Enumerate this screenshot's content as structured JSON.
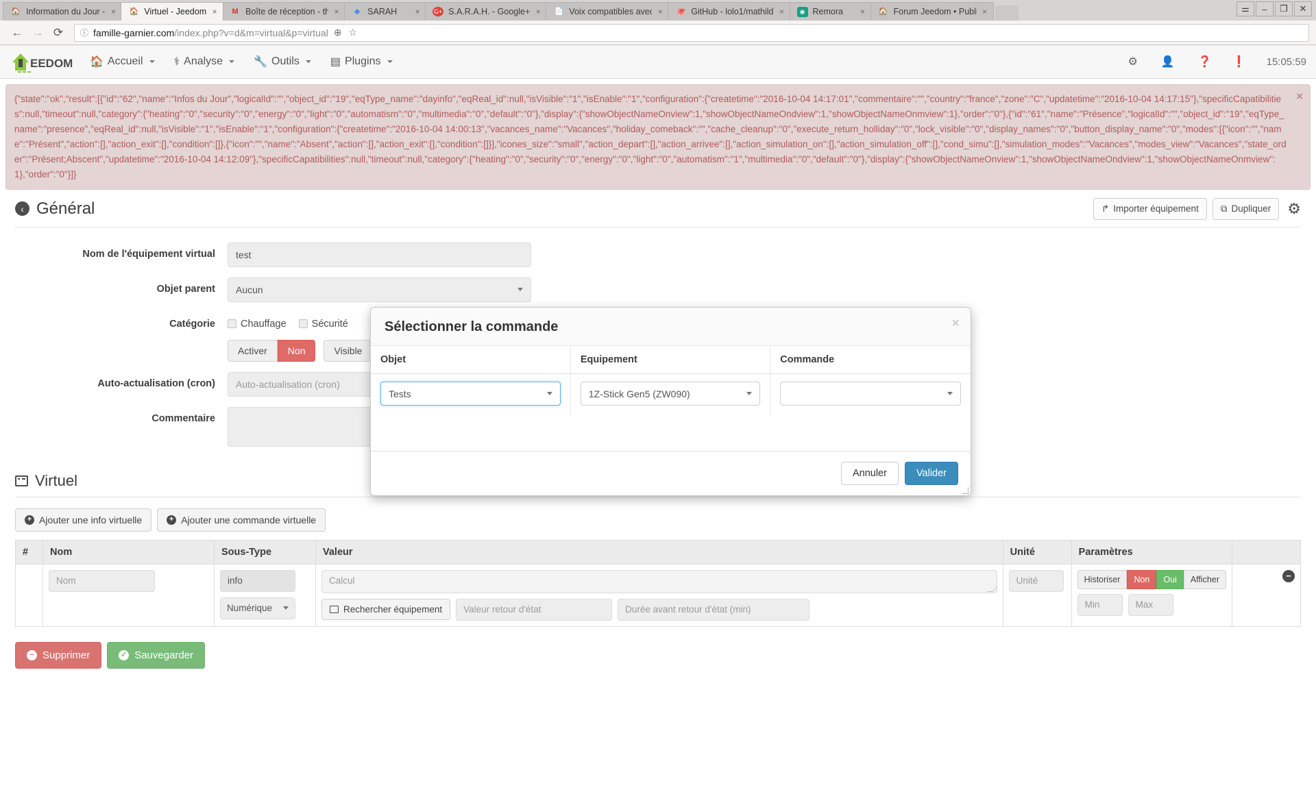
{
  "browser": {
    "tabs": [
      {
        "title": "Information du Jour -",
        "favicon": "jeedom-icon",
        "close_label": "×",
        "active": false
      },
      {
        "title": "Virtuel - Jeedom",
        "favicon": "jeedom-icon",
        "close_label": "×",
        "active": true
      },
      {
        "title": "Boîte de réception - th",
        "favicon": "gmail-icon",
        "close_label": "×",
        "active": false
      },
      {
        "title": "SARAH",
        "favicon": "sarah-icon",
        "close_label": "×",
        "active": false
      },
      {
        "title": "S.A.R.A.H. - Google+",
        "favicon": "googleplus-icon",
        "close_label": "×",
        "active": false
      },
      {
        "title": "Voix compatibles avec",
        "favicon": "document-icon",
        "close_label": "×",
        "active": false
      },
      {
        "title": "GitHub - lolo1/mathild",
        "favicon": "github-icon",
        "close_label": "×",
        "active": false
      },
      {
        "title": "Remora",
        "favicon": "remora-icon",
        "close_label": "×",
        "active": false
      },
      {
        "title": "Forum Jeedom • Publi",
        "favicon": "jeedom-icon",
        "close_label": "×",
        "active": false
      }
    ],
    "window_controls": {
      "profile": "⚌",
      "minimize": "–",
      "maximize": "❐",
      "close": "✕"
    },
    "nav": {
      "back": "←",
      "forward": "→",
      "reload": "⟳"
    },
    "url": {
      "info_icon": "ⓘ",
      "host": "famille-garnier.com",
      "path": "/index.php?v=d&m=virtual&p=virtual",
      "star_icon": "☆",
      "zoom_icon": "⊕"
    }
  },
  "navbar": {
    "brand": "JEEDOM",
    "items": [
      {
        "label": "Accueil",
        "icon": "home-icon"
      },
      {
        "label": "Analyse",
        "icon": "stethoscope-icon"
      },
      {
        "label": "Outils",
        "icon": "wrench-icon"
      },
      {
        "label": "Plugins",
        "icon": "plugins-icon"
      }
    ],
    "right": {
      "gears_icon": "gears-icon",
      "user_icon": "user-icon",
      "help_icon": "question-circle-icon",
      "info_icon": "exclamation-circle-icon",
      "clock": "15:05:59"
    }
  },
  "alert": {
    "close_label": "×",
    "text": "{\"state\":\"ok\",\"result\":[{\"id\":\"62\",\"name\":\"Infos du Jour\",\"logicalId\":\"\",\"object_id\":\"19\",\"eqType_name\":\"dayinfo\",\"eqReal_id\":null,\"isVisible\":\"1\",\"isEnable\":\"1\",\"configuration\":{\"createtime\":\"2016-10-04 14:17:01\",\"commentaire\":\"\",\"country\":\"france\",\"zone\":\"C\",\"updatetime\":\"2016-10-04 14:17:15\"},\"specificCapatibilities\":null,\"timeout\":null,\"category\":{\"heating\":\"0\",\"security\":\"0\",\"energy\":\"0\",\"light\":\"0\",\"automatism\":\"0\",\"multimedia\":\"0\",\"default\":\"0\"},\"display\":{\"showObjectNameOnview\":1,\"showObjectNameOndview\":1,\"showObjectNameOnmview\":1},\"order\":\"0\"},{\"id\":\"61\",\"name\":\"Présence\",\"logicalId\":\"\",\"object_id\":\"19\",\"eqType_name\":\"presence\",\"eqReal_id\":null,\"isVisible\":\"1\",\"isEnable\":\"1\",\"configuration\":{\"createtime\":\"2016-10-04 14:00:13\",\"vacances_name\":\"Vacances\",\"holiday_comeback\":\"\",\"cache_cleanup\":\"0\",\"execute_return_holliday\":\"0\",\"lock_visible\":\"0\",\"display_names\":\"0\",\"button_display_name\":\"0\",\"modes\":[{\"icon\":\"\",\"name\":\"Présent\",\"action\":[],\"action_exit\":[],\"condition\":[]},{\"icon\":\"\",\"name\":\"Absent\",\"action\":[],\"action_exit\":[],\"condition\":[]}],\"icones_size\":\"small\",\"action_depart\":[],\"action_arrivee\":[],\"action_simulation_on\":[],\"action_simulation_off\":[],\"cond_simu\":[],\"simulation_modes\":\"Vacances\",\"modes_view\":\"Vacances\",\"state_order\":\"Présent;Abscent\",\"updatetime\":\"2016-10-04 14:12:09\"},\"specificCapatibilities\":null,\"timeout\":null,\"category\":{\"heating\":\"0\",\"security\":\"0\",\"energy\":\"0\",\"light\":\"0\",\"automatism\":\"1\",\"multimedia\":\"0\",\"default\":\"0\"},\"display\":{\"showObjectNameOnview\":1,\"showObjectNameOndview\":1,\"showObjectNameOnmview\":1},\"order\":\"0\"}]}"
  },
  "general": {
    "title": "Général",
    "back_icon": "‹",
    "import_button": "Importer équipement",
    "import_icon": "↱",
    "duplicate_button": "Dupliquer",
    "duplicate_icon": "⧉",
    "config_gear_icon": "gears-icon",
    "fields": {
      "name_label": "Nom de l'équipement virtual",
      "name_value": "test",
      "parent_label": "Objet parent",
      "parent_value": "Aucun",
      "category_label": "Catégorie",
      "category_options": [
        "Chauffage",
        "Sécurité"
      ],
      "toggle_enable": "Activer",
      "toggle_no": "Non",
      "toggle_visible": "Visible",
      "cron_label": "Auto-actualisation (cron)",
      "cron_placeholder": "Auto-actualisation (cron)",
      "comment_label": "Commentaire"
    }
  },
  "virtuel": {
    "title": "Virtuel",
    "add_info_button": "Ajouter une info virtuelle",
    "add_command_button": "Ajouter une commande virtuelle",
    "add_icon": "+",
    "columns": [
      "#",
      "Nom",
      "Sous-Type",
      "Valeur",
      "Unité",
      "Paramètres",
      ""
    ],
    "row": {
      "index": "",
      "name_placeholder": "Nom",
      "subtype_value": "info",
      "subtype_select": "Numérique",
      "calc_placeholder": "Calcul",
      "search_button": "Rechercher équipement",
      "search_icon": "list-icon",
      "return_value_placeholder": "Valeur retour d'état",
      "return_delay_placeholder": "Durée avant retour d'état (min)",
      "unit_placeholder": "Unité",
      "param_historiser": "Historiser",
      "param_non": "Non",
      "param_oui": "Oui",
      "param_afficher": "Afficher",
      "min_placeholder": "Min",
      "max_placeholder": "Max",
      "delete_icon": "−"
    }
  },
  "footer": {
    "delete_button": "Supprimer",
    "delete_icon": "−",
    "save_button": "Sauvegarder",
    "save_icon": "✓"
  },
  "modal": {
    "title": "Sélectionner la commande",
    "close_label": "×",
    "columns": [
      "Objet",
      "Equipement",
      "Commande"
    ],
    "objet_value": "Tests",
    "equipement_value": "1Z-Stick Gen5 (ZW090)",
    "commande_value": "",
    "cancel_button": "Annuler",
    "validate_button": "Valider"
  },
  "colors": {
    "danger": "#d9534f",
    "success": "#5cb85c",
    "primary": "#3c8dbc",
    "alert_bg": "#e4d4d4",
    "alert_text": "#b05b5b",
    "jeedom_green": "#8dc63f"
  }
}
